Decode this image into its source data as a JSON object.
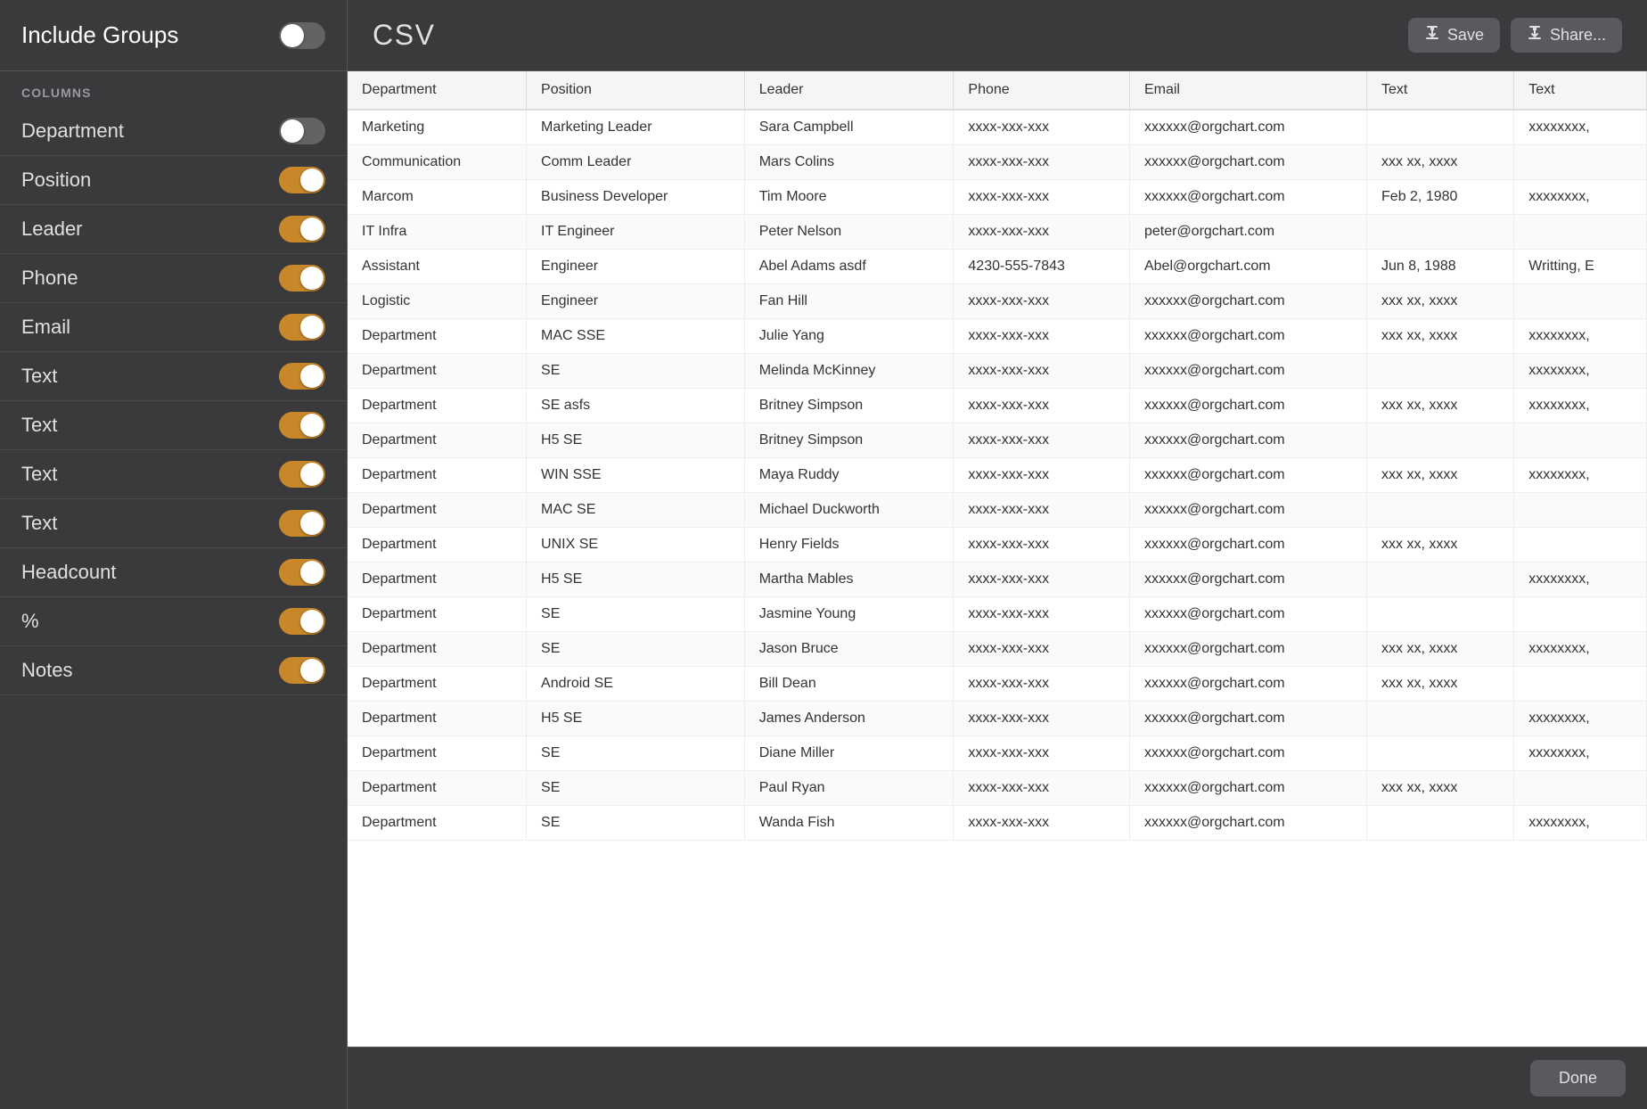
{
  "sidebar": {
    "include_groups_label": "Include Groups",
    "include_groups_on": false,
    "columns_section_label": "COLUMNS",
    "columns": [
      {
        "label": "Department",
        "on": false
      },
      {
        "label": "Position",
        "on": true
      },
      {
        "label": "Leader",
        "on": true
      },
      {
        "label": "Phone",
        "on": true
      },
      {
        "label": "Email",
        "on": true
      },
      {
        "label": "Text",
        "on": true
      },
      {
        "label": "Text",
        "on": true
      },
      {
        "label": "Text",
        "on": true
      },
      {
        "label": "Text",
        "on": true
      },
      {
        "label": "Headcount",
        "on": true
      },
      {
        "label": "%",
        "on": true
      },
      {
        "label": "Notes",
        "on": true
      }
    ]
  },
  "header": {
    "title": "CSV",
    "save_label": "Save",
    "share_label": "Share..."
  },
  "footer": {
    "done_label": "Done"
  },
  "table": {
    "columns": [
      "Department",
      "Position",
      "Leader",
      "Phone",
      "Email",
      "Text",
      "Text"
    ],
    "rows": [
      [
        "Marketing",
        "Marketing Leader",
        "Sara Campbell",
        "xxxx-xxx-xxx",
        "xxxxxx@orgchart.com",
        "",
        "xxxxxxxx,"
      ],
      [
        "Communication",
        "Comm Leader",
        "Mars Colins",
        "xxxx-xxx-xxx",
        "xxxxxx@orgchart.com",
        "xxx xx, xxxx",
        ""
      ],
      [
        "Marcom",
        "Business Developer",
        "Tim Moore",
        "xxxx-xxx-xxx",
        "xxxxxx@orgchart.com",
        "Feb 2, 1980",
        "xxxxxxxx,"
      ],
      [
        "IT Infra",
        "IT Engineer",
        "Peter Nelson",
        "xxxx-xxx-xxx",
        "peter@orgchart.com",
        "",
        ""
      ],
      [
        "Assistant",
        "Engineer",
        "Abel Adams asdf",
        "4230-555-7843",
        "Abel@orgchart.com",
        "Jun 8, 1988",
        "Writting, E"
      ],
      [
        "Logistic",
        "Engineer",
        "Fan Hill",
        "xxxx-xxx-xxx",
        "xxxxxx@orgchart.com",
        "xxx xx, xxxx",
        ""
      ],
      [
        "Department",
        "MAC SSE",
        "Julie Yang",
        "xxxx-xxx-xxx",
        "xxxxxx@orgchart.com",
        "xxx xx, xxxx",
        "xxxxxxxx,"
      ],
      [
        "Department",
        "SE",
        "Melinda McKinney",
        "xxxx-xxx-xxx",
        "xxxxxx@orgchart.com",
        "",
        "xxxxxxxx,"
      ],
      [
        "Department",
        "SE asfs",
        "Britney Simpson",
        "xxxx-xxx-xxx",
        "xxxxxx@orgchart.com",
        "xxx xx, xxxx",
        "xxxxxxxx,"
      ],
      [
        "Department",
        "H5 SE",
        "Britney Simpson",
        "xxxx-xxx-xxx",
        "xxxxxx@orgchart.com",
        "",
        ""
      ],
      [
        "Department",
        "WIN SSE",
        "Maya Ruddy",
        "xxxx-xxx-xxx",
        "xxxxxx@orgchart.com",
        "xxx xx, xxxx",
        "xxxxxxxx,"
      ],
      [
        "Department",
        "MAC SE",
        "Michael Duckworth",
        "xxxx-xxx-xxx",
        "xxxxxx@orgchart.com",
        "",
        ""
      ],
      [
        "Department",
        "UNIX SE",
        "Henry Fields",
        "xxxx-xxx-xxx",
        "xxxxxx@orgchart.com",
        "xxx xx, xxxx",
        ""
      ],
      [
        "Department",
        "H5 SE",
        "Martha Mables",
        "xxxx-xxx-xxx",
        "xxxxxx@orgchart.com",
        "",
        "xxxxxxxx,"
      ],
      [
        "Department",
        "SE",
        "Jasmine Young",
        "xxxx-xxx-xxx",
        "xxxxxx@orgchart.com",
        "",
        ""
      ],
      [
        "Department",
        "SE",
        "Jason Bruce",
        "xxxx-xxx-xxx",
        "xxxxxx@orgchart.com",
        "xxx xx, xxxx",
        "xxxxxxxx,"
      ],
      [
        "Department",
        "Android SE",
        "Bill Dean",
        "xxxx-xxx-xxx",
        "xxxxxx@orgchart.com",
        "xxx xx, xxxx",
        ""
      ],
      [
        "Department",
        "H5 SE",
        "James Anderson",
        "xxxx-xxx-xxx",
        "xxxxxx@orgchart.com",
        "",
        "xxxxxxxx,"
      ],
      [
        "Department",
        "SE",
        "Diane Miller",
        "xxxx-xxx-xxx",
        "xxxxxx@orgchart.com",
        "",
        "xxxxxxxx,"
      ],
      [
        "Department",
        "SE",
        "Paul Ryan",
        "xxxx-xxx-xxx",
        "xxxxxx@orgchart.com",
        "xxx xx, xxxx",
        ""
      ],
      [
        "Department",
        "SE",
        "Wanda Fish",
        "xxxx-xxx-xxx",
        "xxxxxx@orgchart.com",
        "",
        "xxxxxxxx,"
      ]
    ]
  }
}
